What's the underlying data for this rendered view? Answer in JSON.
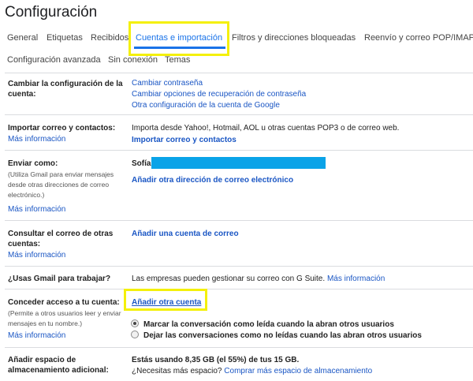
{
  "page": {
    "title": "Configuración"
  },
  "tabs": {
    "general": "General",
    "labels": "Etiquetas",
    "inbox": "Recibidos",
    "accounts": "Cuentas e importación",
    "filters": "Filtros y direcciones bloqueadas",
    "forwarding": "Reenvío y correo POP/IMAP",
    "advanced": "Configuración avanzada",
    "offline": "Sin conexión",
    "themes": "Temas"
  },
  "common": {
    "more_info": "Más información"
  },
  "sections": {
    "change_account": {
      "label_line1": "Cambiar la configuración de la",
      "label_line2": "cuenta:",
      "link1": "Cambiar contraseña",
      "link2": "Cambiar opciones de recuperación de contraseña",
      "link3": "Otra configuración de la cuenta de Google"
    },
    "import": {
      "label": "Importar correo y contactos:",
      "desc": "Importa desde Yahoo!, Hotmail, AOL u otras cuentas POP3 o de correo web.",
      "action": "Importar correo y contactos"
    },
    "send_as": {
      "label": "Enviar como:",
      "sub1": "(Utiliza Gmail para enviar mensajes",
      "sub2": "desde otras direcciones de correo",
      "sub3": "electrónico.)",
      "name": "Sofía",
      "action": "Añadir otra dirección de correo electrónico"
    },
    "check_mail": {
      "label_line1": "Consultar el correo de otras",
      "label_line2": "cuentas:",
      "action": "Añadir una cuenta de correo"
    },
    "work": {
      "label": "¿Usas Gmail para trabajar?",
      "desc": "Las empresas pueden gestionar su correo con G Suite.",
      "link": "Más información"
    },
    "grant_access": {
      "label": "Conceder acceso a tu cuenta:",
      "sub1": "(Permite a otros usuarios leer y enviar",
      "sub2": "mensajes en tu nombre.)",
      "action": "Añadir otra cuenta",
      "radio1": "Marcar la conversación como leída cuando la abran otros usuarios",
      "radio2": "Dejar las conversaciones como no leídas cuando las abran otros usuarios"
    },
    "storage": {
      "label_line1": "Añadir espacio de",
      "label_line2": "almacenamiento adicional:",
      "usage": "Estás usando 8,35 GB (el 55%) de tus 15 GB.",
      "question": "¿Necesitas más espacio?",
      "link": "Comprar más espacio de almacenamiento"
    }
  },
  "colors": {
    "accent": "#1a73e8",
    "link": "#1a56c4",
    "highlight": "#f4f00b",
    "redaction": "#0aa3e8"
  }
}
